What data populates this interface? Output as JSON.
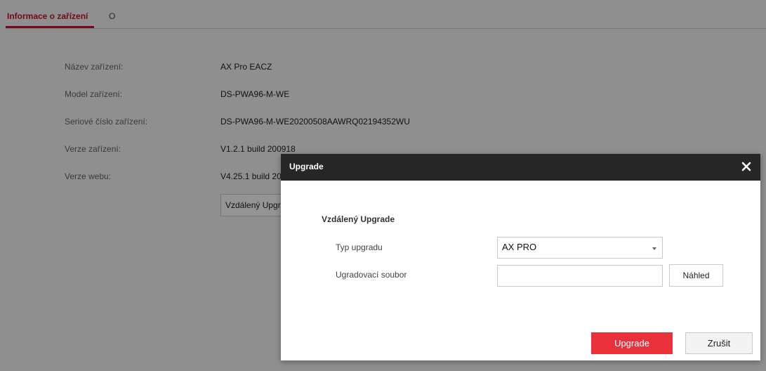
{
  "tabs": {
    "active": "Informace o zařízení",
    "other": "O"
  },
  "device_info": {
    "rows": [
      {
        "label": "Název zařízení:",
        "value": "AX Pro EACZ"
      },
      {
        "label": "Model zařízení:",
        "value": "DS-PWA96-M-WE"
      },
      {
        "label": "Seriové číslo zařízení:",
        "value": "DS-PWA96-M-WE20200508AAWRQ02194352WU"
      },
      {
        "label": "Verze zařízení:",
        "value": "V1.2.1 build 200918"
      },
      {
        "label": "Verze webu:",
        "value": "V4.25.1 build 20"
      }
    ],
    "remote_upgrade_button": "Vzdálený Upgr"
  },
  "dialog": {
    "title": "Upgrade",
    "close_icon": "close-icon",
    "section_title": "Vzdálený Upgrade",
    "type_label": "Typ upgradu",
    "type_value": "AX PRO",
    "file_label": "Ugradovací soubor",
    "file_value": "",
    "file_placeholder": "",
    "browse_button": "Náhled",
    "upgrade_button": "Upgrade",
    "cancel_button": "Zrušit"
  },
  "colors": {
    "accent": "#c8102e",
    "primary_button": "#e8313b",
    "dialog_header": "#262626"
  }
}
